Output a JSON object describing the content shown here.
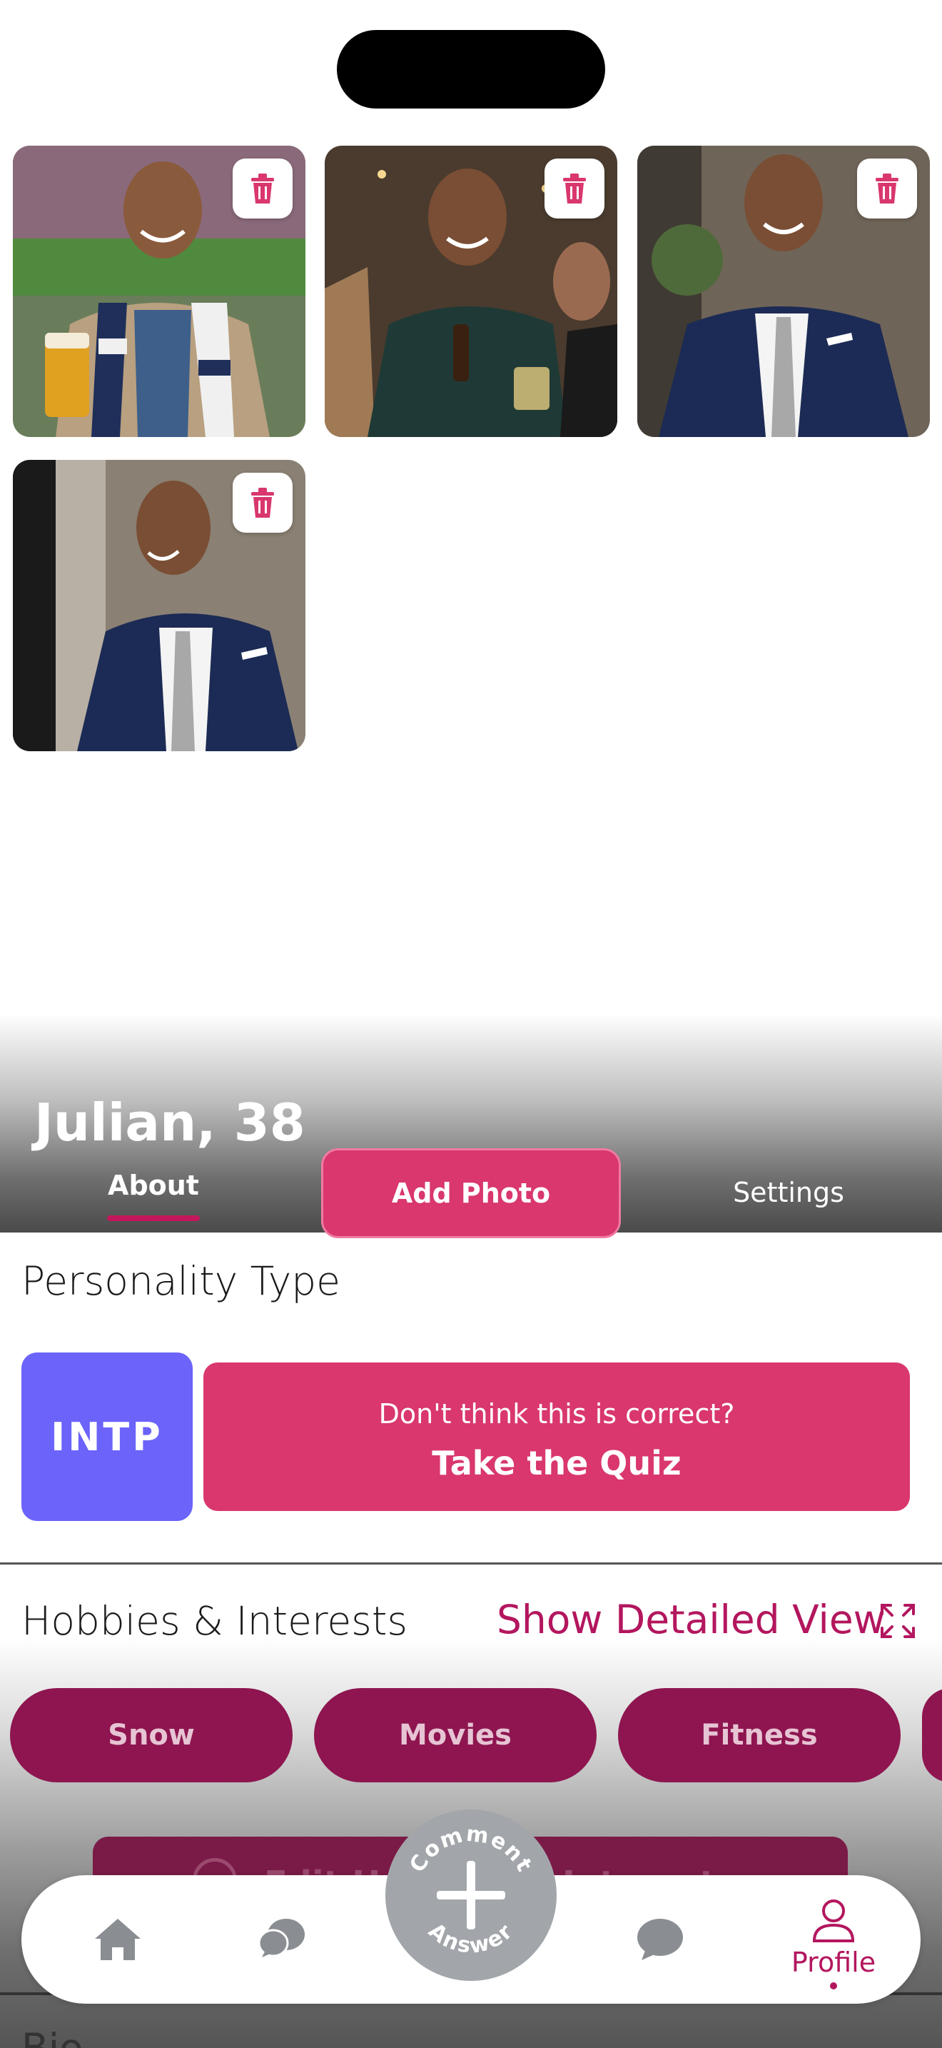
{
  "profile": {
    "name_age": "Julian, 38"
  },
  "photos": [
    {
      "subject": "man at stadium with scarf and beer"
    },
    {
      "subject": "man at party holding beer"
    },
    {
      "subject": "man in navy suit"
    },
    {
      "subject": "man in navy suit looking aside"
    }
  ],
  "tabs": {
    "about": "About",
    "add_photo": "Add Photo",
    "settings": "Settings"
  },
  "personality": {
    "title": "Personality Type",
    "type": "INTP",
    "quiz_prompt": "Don't think this is correct?",
    "quiz_action": "Take the Quiz"
  },
  "hobbies": {
    "title": "Hobbies & Interests",
    "detailed_link": "Show Detailed View",
    "chips": [
      "Snow",
      "Movies",
      "Fitness"
    ],
    "edit_label": "Edit Hobbies & Interests"
  },
  "bio": {
    "title": "Bio"
  },
  "tabbar": {
    "fab_top": "Comment",
    "fab_bottom": "Answer",
    "profile_label": "Profile"
  },
  "colors": {
    "accent": "#d9376e",
    "accent_dark": "#b3165e",
    "chip": "#8e1550",
    "personality": "#6b63fa"
  },
  "icons": [
    "trash-icon",
    "expand-icon",
    "home-icon",
    "chat-icon",
    "plus-icon",
    "profile-icon"
  ]
}
